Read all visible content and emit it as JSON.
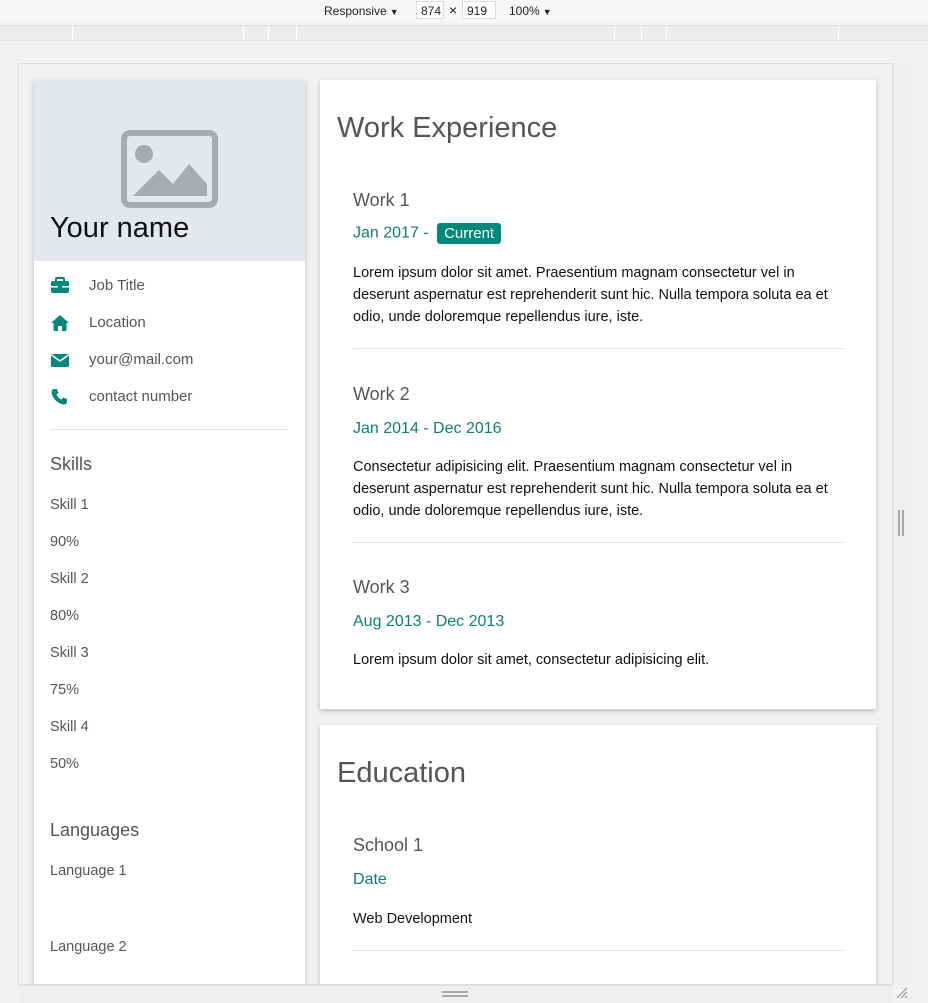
{
  "devtools": {
    "device_label": "Responsive",
    "width_value": "874",
    "times_symbol": "×",
    "height_value": "919",
    "zoom_label": "100%"
  },
  "profile": {
    "name": "Your name",
    "info": [
      {
        "icon": "briefcase-icon",
        "text": "Job Title"
      },
      {
        "icon": "home-icon",
        "text": "Location"
      },
      {
        "icon": "mail-icon",
        "text": "your@mail.com"
      },
      {
        "icon": "phone-icon",
        "text": "contact number"
      }
    ],
    "skills_title": "Skills",
    "skills": [
      {
        "name": "Skill 1",
        "percent": "90%"
      },
      {
        "name": "Skill 2",
        "percent": "80%"
      },
      {
        "name": "Skill 3",
        "percent": "75%"
      },
      {
        "name": "Skill 4",
        "percent": "50%"
      }
    ],
    "languages_title": "Languages",
    "languages": [
      "Language 1",
      "Language 2"
    ]
  },
  "work": {
    "title": "Work Experience",
    "items": [
      {
        "name": "Work 1",
        "date": "Jan 2017 - ",
        "badge": "Current",
        "desc": "Lorem ipsum dolor sit amet. Praesentium magnam consectetur vel in deserunt aspernatur est reprehenderit sunt hic. Nulla tempora soluta ea et odio, unde doloremque repellendus iure, iste."
      },
      {
        "name": "Work 2",
        "date": "Jan 2014 - Dec 2016",
        "desc": "Consectetur adipisicing elit. Praesentium magnam consectetur vel in deserunt aspernatur est reprehenderit sunt hic. Nulla tempora soluta ea et odio, unde doloremque repellendus iure, iste."
      },
      {
        "name": "Work 3",
        "date": "Aug 2013 - Dec 2013",
        "desc": "Lorem ipsum dolor sit amet, consectetur adipisicing elit."
      }
    ]
  },
  "education": {
    "title": "Education",
    "items": [
      {
        "name": "School 1",
        "date": "Date",
        "desc": "Web Development"
      }
    ]
  },
  "colors": {
    "accent": "#00897b",
    "accent_text": "#0d7f72",
    "photo_bg": "#e4e8ec"
  }
}
